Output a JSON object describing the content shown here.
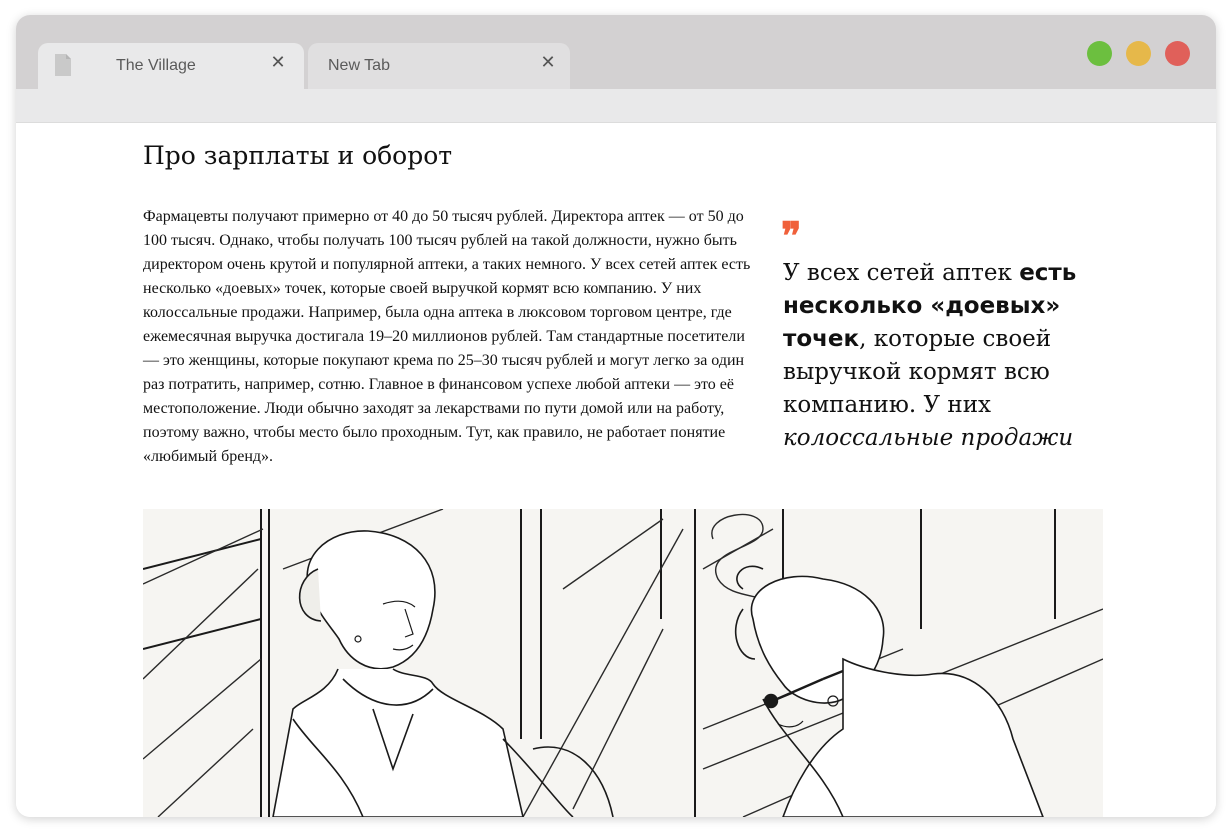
{
  "browser": {
    "tabs": [
      {
        "label": "The Village",
        "active": true
      },
      {
        "label": "New Tab",
        "active": false
      }
    ],
    "close_glyph": "✕",
    "traffic_lights": {
      "green": "#6cbf3f",
      "yellow": "#e6b84a",
      "red": "#e0605a"
    }
  },
  "article": {
    "section_title": "Про зарплаты и оборот",
    "paragraph": "Фармацевты получают примерно от 40 до 50 тысяч рублей. Директора аптек — от 50 до 100 тысяч. Однако, чтобы получать 100 тысяч рублей на такой должности, нужно быть директором очень крутой и популярной аптеки, а таких немного. У всех сетей аптек есть несколько «доевых» точек, которые своей выручкой кормят всю компанию. У них колоссальные продажи. Например, была одна аптека в люксовом торговом центре, где ежемесячная выручка достигала 19–20 миллионов рублей. Там стандартные посетители — это женщины, которые покупают крема по 25–30 тысяч рублей и могут легко за один раз потратить, например, сотню. Главное в финансовом успехе любой аптеки — это её местоположение. Люди обычно заходят за лекарствами по пути домой или на работу, поэтому важно, чтобы место было проходным. Тут, как правило, не работает понятие «любимый бренд».",
    "quote": {
      "mark": "❞",
      "part1": "У всех сетей аптек ",
      "bold": "есть несколько «доевых» точек",
      "part2": ", которые своей выручкой кормят всю компанию. У них ",
      "italic": "колоссальные продажи"
    }
  },
  "colors": {
    "accent": "#f0603a"
  }
}
